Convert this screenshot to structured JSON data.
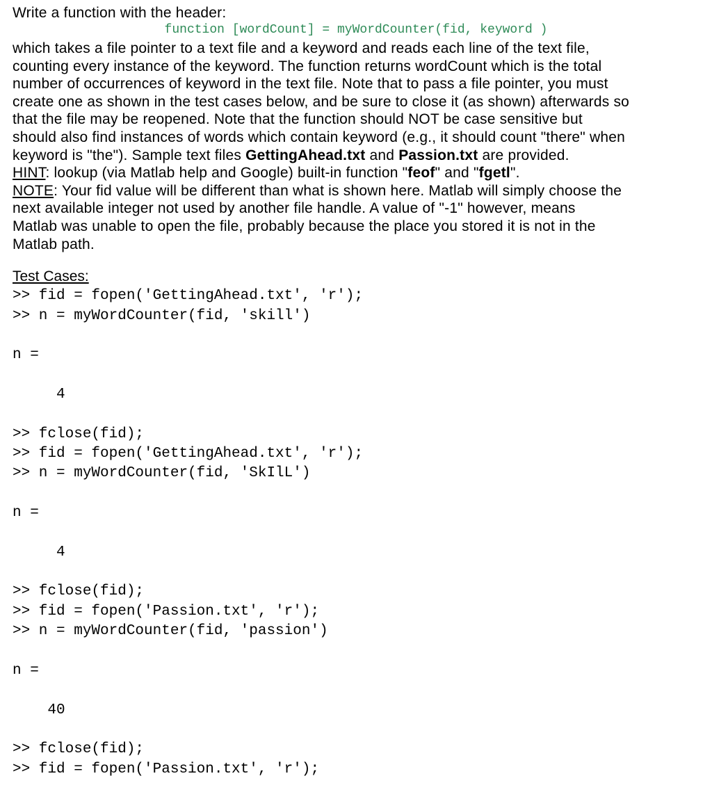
{
  "intro_line": "Write a function with the header:",
  "function_signature": "function [wordCount] = myWordCounter(fid, keyword )",
  "paragraph_lines": [
    "which takes a file pointer to a text file and a keyword and reads each line of the text file,",
    "counting every instance of the keyword.  The function returns wordCount which is the total",
    "number of occurrences of keyword in the text file.  Note that to pass a file pointer, you must",
    "create one as shown in the test cases below, and be sure to close it (as shown) afterwards so",
    "that the file may be reopened.  Note that the function should NOT be case sensitive but",
    "should also find instances of words which contain keyword (e.g., it should count \"there\" when"
  ],
  "sample_line": {
    "pre": "keyword is \"the\").  Sample text files ",
    "file1": "GettingAhead.txt",
    "mid": " and ",
    "file2": "Passion.txt",
    "post": " are provided."
  },
  "hint_line": {
    "label": "HINT",
    "pre": ":  lookup (via Matlab help and Google) built-in function \"",
    "fn1": "feof",
    "mid": "\" and \"",
    "fn2": "fgetl",
    "post": "\"."
  },
  "note_line": {
    "label": "NOTE",
    "rest": ":  Your fid value will be different than what is shown here.  Matlab will simply choose the"
  },
  "note_cont1": "next available integer not used by another file handle.  A value of \"-1\" however, means",
  "note_cont2": "Matlab was unable to open the file, probably because the place you stored it is not in the",
  "note_cont3": "Matlab path.",
  "test_cases_label": "Test Cases:",
  "console": ">> fid = fopen('GettingAhead.txt', 'r');\n>> n = myWordCounter(fid, 'skill')\n\nn =\n\n     4\n\n>> fclose(fid);\n>> fid = fopen('GettingAhead.txt', 'r');\n>> n = myWordCounter(fid, 'SkIlL')\n\nn =\n\n     4\n\n>> fclose(fid);\n>> fid = fopen('Passion.txt', 'r');\n>> n = myWordCounter(fid, 'passion')\n\nn =\n\n    40\n\n>> fclose(fid);\n>> fid = fopen('Passion.txt', 'r');"
}
